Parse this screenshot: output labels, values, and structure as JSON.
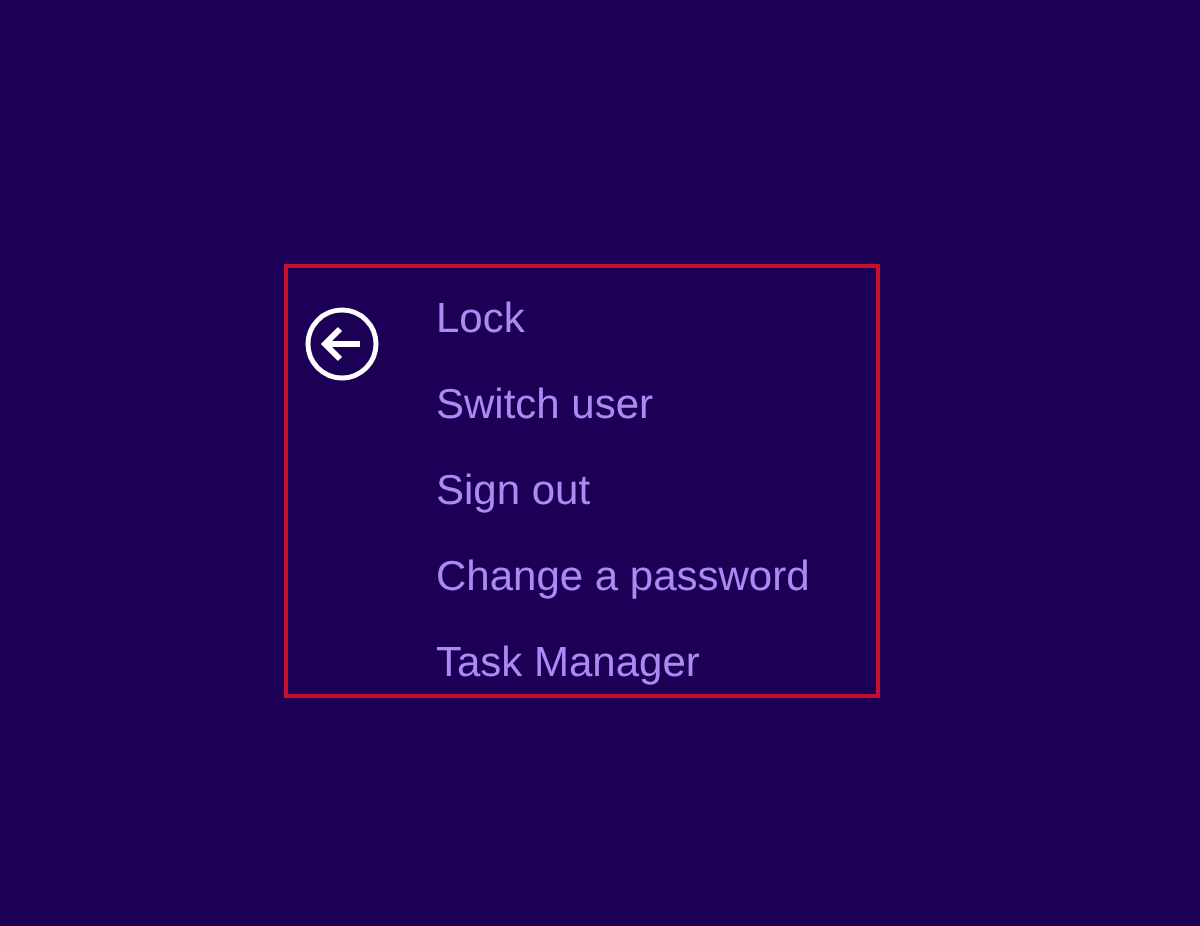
{
  "menu_items": [
    {
      "label": "Lock"
    },
    {
      "label": "Switch user"
    },
    {
      "label": "Sign out"
    },
    {
      "label": "Change a password"
    },
    {
      "label": "Task Manager"
    }
  ]
}
